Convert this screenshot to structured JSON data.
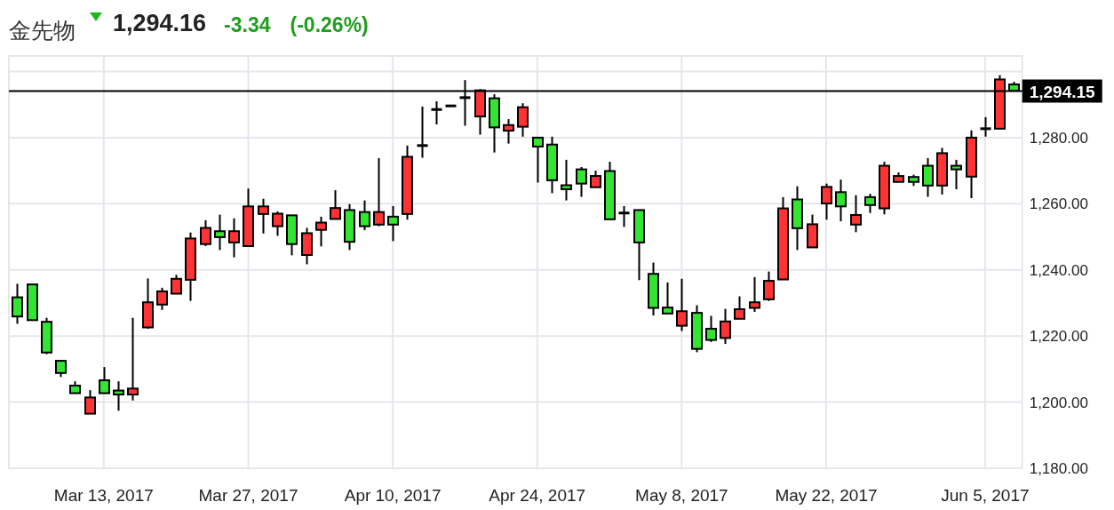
{
  "header": {
    "title": "金先物",
    "down": true,
    "price": "1,294.16",
    "change": "-3.34",
    "change_percent": "(-0.26%)"
  },
  "chart_data": {
    "type": "candlestick",
    "categories": [
      null,
      null,
      null,
      null,
      null,
      null,
      "Mar 13, 2017",
      null,
      null,
      null,
      null,
      null,
      null,
      null,
      null,
      null,
      "Mar 27, 2017",
      null,
      null,
      null,
      null,
      null,
      null,
      null,
      null,
      null,
      "Apr 10, 2017",
      null,
      null,
      null,
      null,
      null,
      null,
      null,
      null,
      null,
      "Apr 24, 2017",
      null,
      null,
      null,
      null,
      null,
      null,
      null,
      null,
      null,
      "May 8, 2017",
      null,
      null,
      null,
      null,
      null,
      null,
      null,
      null,
      null,
      "May 22, 2017",
      null,
      null,
      null,
      null,
      null,
      null,
      null,
      null,
      null,
      null,
      "Jun 5, 2017",
      null,
      null
    ],
    "ohlc": [
      [
        1231.7,
        1235.8,
        1223.7,
        1225.9
      ],
      [
        1235.6,
        1235.6,
        1224.8,
        1224.8
      ],
      [
        1224.3,
        1225.5,
        1214.5,
        1215.0
      ],
      [
        1212.5,
        1212.5,
        1207.6,
        1208.8
      ],
      [
        1205.0,
        1206.3,
        1202.7,
        1202.7
      ],
      [
        1196.5,
        1203.6,
        1196.5,
        1201.4
      ],
      [
        1206.6,
        1210.6,
        1202.7,
        1202.7
      ],
      [
        1203.5,
        1206.3,
        1197.4,
        1202.3
      ],
      [
        1202.3,
        1225.5,
        1200.5,
        1204.1
      ],
      [
        1222.6,
        1237.4,
        1222.2,
        1230.2
      ],
      [
        1229.5,
        1234.6,
        1227.9,
        1233.5
      ],
      [
        1232.8,
        1238.5,
        1232.8,
        1237.3
      ],
      [
        1237.0,
        1251.3,
        1230.6,
        1249.5
      ],
      [
        1247.8,
        1255.0,
        1247.2,
        1252.7
      ],
      [
        1251.7,
        1256.7,
        1246.0,
        1249.9
      ],
      [
        1248.3,
        1255.6,
        1243.8,
        1251.7
      ],
      [
        1247.2,
        1264.6,
        1247.2,
        1259.2
      ],
      [
        1256.9,
        1261.5,
        1251.0,
        1259.2
      ],
      [
        1253.2,
        1257.7,
        1250.3,
        1257.0
      ],
      [
        1256.5,
        1256.5,
        1244.4,
        1247.8
      ],
      [
        1244.5,
        1252.7,
        1241.7,
        1251.1
      ],
      [
        1252.1,
        1256.1,
        1247.1,
        1254.3
      ],
      [
        1255.4,
        1264.1,
        1255.4,
        1258.7
      ],
      [
        1258.1,
        1259.9,
        1246.0,
        1248.5
      ],
      [
        1257.5,
        1261.0,
        1252.0,
        1253.2
      ],
      [
        1253.7,
        1273.8,
        1253.2,
        1257.5
      ],
      [
        1256.1,
        1259.3,
        1248.7,
        1253.7
      ],
      [
        1256.9,
        1277.6,
        1255.2,
        1274.2
      ],
      [
        1277.6,
        1289.4,
        1273.9,
        1277.6
      ],
      [
        1288.5,
        1291.0,
        1284.0,
        1288.5
      ],
      [
        1289.6,
        1289.6,
        1289.6,
        1289.6
      ],
      [
        1292.1,
        1297.4,
        1283.6,
        1292.1
      ],
      [
        1286.4,
        1294.7,
        1280.9,
        1294.3
      ],
      [
        1291.9,
        1293.1,
        1275.5,
        1283.1
      ],
      [
        1282.1,
        1285.6,
        1278.2,
        1283.8
      ],
      [
        1283.3,
        1290.4,
        1280.3,
        1289.2
      ],
      [
        1280.0,
        1280.0,
        1266.4,
        1277.3
      ],
      [
        1277.9,
        1280.3,
        1263.2,
        1267.1
      ],
      [
        1265.6,
        1273.3,
        1261.0,
        1264.4
      ],
      [
        1270.4,
        1271.1,
        1262.1,
        1266.1
      ],
      [
        1265.0,
        1270.0,
        1265.0,
        1268.4
      ],
      [
        1269.9,
        1272.7,
        1255.3,
        1255.3
      ],
      [
        1257.2,
        1259.3,
        1253.0,
        1257.2
      ],
      [
        1258.1,
        1258.1,
        1236.9,
        1248.3
      ],
      [
        1238.8,
        1242.2,
        1226.2,
        1228.5
      ],
      [
        1228.6,
        1236.2,
        1226.8,
        1226.8
      ],
      [
        1223.1,
        1237.3,
        1221.5,
        1227.5
      ],
      [
        1227.0,
        1229.3,
        1215.1,
        1216.1
      ],
      [
        1222.2,
        1226.1,
        1218.2,
        1218.8
      ],
      [
        1219.4,
        1228.2,
        1217.6,
        1224.4
      ],
      [
        1225.2,
        1232.0,
        1225.2,
        1228.1
      ],
      [
        1228.5,
        1237.8,
        1227.3,
        1230.2
      ],
      [
        1231.1,
        1239.5,
        1230.6,
        1236.7
      ],
      [
        1237.1,
        1262.0,
        1237.1,
        1258.6
      ],
      [
        1261.3,
        1265.3,
        1246.0,
        1252.6
      ],
      [
        1246.8,
        1256.7,
        1246.8,
        1253.8
      ],
      [
        1260.1,
        1266.1,
        1255.2,
        1265.1
      ],
      [
        1263.5,
        1267.3,
        1254.7,
        1259.2
      ],
      [
        1253.7,
        1262.6,
        1251.4,
        1256.6
      ],
      [
        1262.0,
        1263.0,
        1257.2,
        1259.6
      ],
      [
        1258.6,
        1272.7,
        1256.8,
        1271.5
      ],
      [
        1266.6,
        1269.5,
        1266.6,
        1268.4
      ],
      [
        1268.1,
        1268.8,
        1265.4,
        1266.6
      ],
      [
        1271.5,
        1273.8,
        1262.1,
        1265.5
      ],
      [
        1265.5,
        1276.9,
        1262.8,
        1275.3
      ],
      [
        1271.5,
        1273.3,
        1264.4,
        1270.4
      ],
      [
        1268.2,
        1282.2,
        1261.7,
        1280.0
      ],
      [
        1282.7,
        1286.2,
        1280.3,
        1282.7
      ],
      [
        1282.7,
        1298.9,
        1282.7,
        1297.6
      ],
      [
        1296.1,
        1296.9,
        1294.2,
        1294.2
      ]
    ],
    "ylim": [
      1180,
      1304.7
    ],
    "yticks": [
      {
        "value": 1180,
        "label": "1,180.00"
      },
      {
        "value": 1200,
        "label": "1,200.00"
      },
      {
        "value": 1220,
        "label": "1,220.00"
      },
      {
        "value": 1240,
        "label": "1,240.00"
      },
      {
        "value": 1260,
        "label": "1,260.00"
      },
      {
        "value": 1280,
        "label": "1,280.00"
      }
    ],
    "grid": true,
    "ref_lines": [
      {
        "axis": "y",
        "value": 1294.15,
        "label": "1,294.15"
      }
    ]
  }
}
